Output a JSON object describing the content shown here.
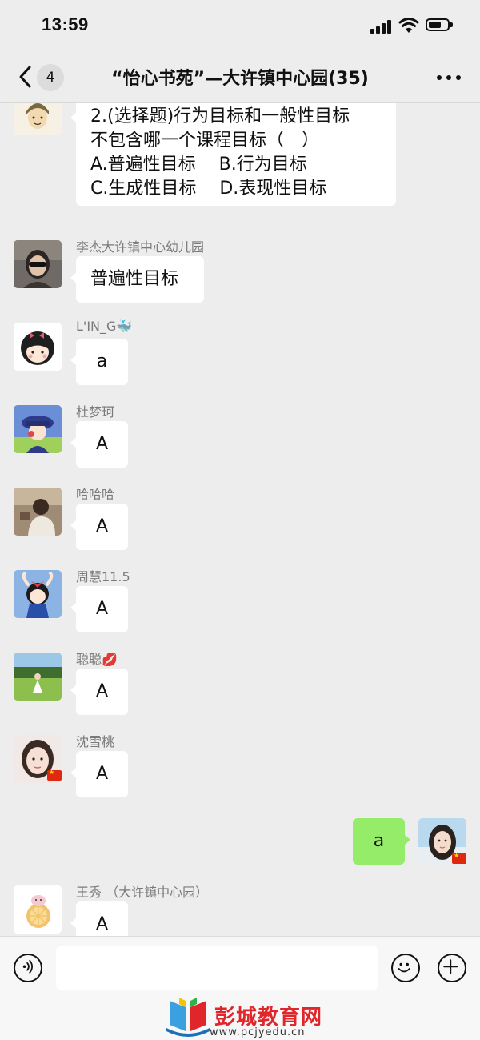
{
  "status": {
    "time": "13:59"
  },
  "nav": {
    "unread": "4",
    "title": "“怡心书苑”—大许镇中心园(35)"
  },
  "question": {
    "lines": [
      "2.(选择题)行为目标和一般性目标",
      "不包含哪一个课程目标（　）",
      "A.普遍性目标　 B.行为目标",
      "C.生成性目标　 D.表现性目标"
    ]
  },
  "messages": [
    {
      "sender": "李杰大许镇中心幼儿园",
      "text": "普遍性目标"
    },
    {
      "sender": "L'IN_G🐳",
      "text": "a"
    },
    {
      "sender": "杜梦珂",
      "text": "A"
    },
    {
      "sender": "哈哈哈",
      "text": "A"
    },
    {
      "sender": "周慧11.5",
      "text": "A"
    },
    {
      "sender": "聪聪💋",
      "text": "A"
    },
    {
      "sender": "沈雪桃",
      "text": "A"
    },
    {
      "sender": "王秀 （大许镇中心园）",
      "text": "A"
    }
  ],
  "my_message": {
    "text": "a"
  },
  "icons": {
    "back": "chevron-left-icon",
    "more": "more-dots-icon",
    "voice": "voice-icon",
    "emoji": "emoji-icon",
    "plus": "plus-icon"
  },
  "colors": {
    "my_bubble": "#95ec69",
    "background": "#ededed",
    "watermark": "#e0262a"
  },
  "watermark": {
    "title": "彭城教育网",
    "url": "www.pcjyedu.cn"
  }
}
